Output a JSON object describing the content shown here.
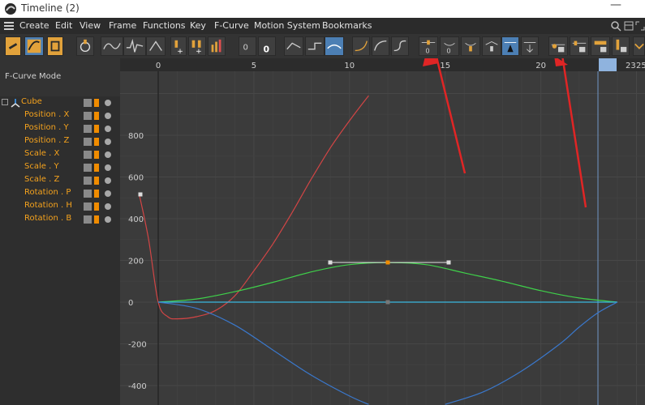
{
  "window": {
    "title": "Timeline (2)",
    "minimize_glyph": "—",
    "app_icon": "cinema4d-icon"
  },
  "menu": {
    "items": [
      "Create",
      "Edit",
      "View",
      "Frame",
      "Functions",
      "Key",
      "F-Curve",
      "Motion System",
      "Bookmarks"
    ]
  },
  "panel": {
    "mode_label": "F-Curve Mode",
    "object": "Cube",
    "tracks": [
      "Position . X",
      "Position . Y",
      "Position . Z",
      "Scale . X",
      "Scale . Y",
      "Scale . Z",
      "Rotation . P",
      "Rotation . H",
      "Rotation . B"
    ]
  },
  "ruler": {
    "labels": [
      "0",
      "5",
      "10",
      "15",
      "20",
      "23",
      "25"
    ],
    "current_frame": "23"
  },
  "graph": {
    "y_labels": [
      "800",
      "600",
      "400",
      "200",
      "0",
      "-200",
      "-400"
    ]
  },
  "colors": {
    "curve_red": "#d24545",
    "curve_green": "#3fd04a",
    "curve_blue": "#3a78cc",
    "curve_cyan": "#39b8e0",
    "track_orange": "#f4a21d",
    "annotation_arrow": "#e02525"
  },
  "chart_data": {
    "type": "line",
    "xlim": [
      -2,
      25
    ],
    "ylim": [
      -480,
      1010
    ],
    "series": [
      {
        "color": "red",
        "x": [
          -1,
          -0.5,
          0,
          0.5,
          1,
          2,
          3,
          4,
          5,
          6,
          7,
          8,
          9,
          10,
          11
        ],
        "values": [
          520,
          300,
          0,
          -70,
          -80,
          -70,
          -40,
          30,
          150,
          280,
          430,
          590,
          740,
          870,
          990
        ]
      },
      {
        "color": "green",
        "x": [
          0,
          2,
          4,
          6,
          8,
          10,
          12,
          14,
          16,
          18,
          20,
          22,
          24
        ],
        "values": [
          0,
          15,
          50,
          95,
          145,
          180,
          190,
          180,
          140,
          100,
          55,
          20,
          0
        ]
      },
      {
        "color": "cyan",
        "x": [
          0,
          24
        ],
        "values": [
          0,
          0
        ]
      },
      {
        "color": "blue",
        "x": [
          0,
          2,
          4,
          6,
          8,
          10,
          11
        ],
        "values": [
          0,
          -30,
          -110,
          -230,
          -350,
          -450,
          -490
        ]
      },
      {
        "color": "blue",
        "x": [
          15,
          17,
          19,
          21,
          22,
          23,
          24
        ],
        "values": [
          -490,
          -430,
          -330,
          -200,
          -120,
          -50,
          0
        ]
      }
    ]
  }
}
